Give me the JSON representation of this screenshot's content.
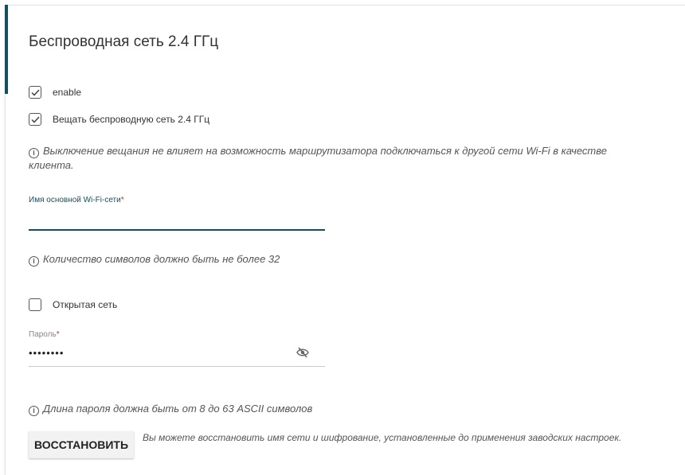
{
  "section": {
    "title": "Беспроводная сеть 2.4 ГГц"
  },
  "checkboxes": {
    "enable": {
      "label": "enable",
      "checked": true
    },
    "broadcast": {
      "label": "Вещать беспроводную сеть 2.4 ГГц",
      "checked": true
    },
    "open_network": {
      "label": "Открытая сеть",
      "checked": false
    }
  },
  "info": {
    "broadcast_note": "Выключение вещания не влияет на возможность маршрутизатора подключаться к другой сети Wi-Fi в качестве клиента.",
    "ssid_note": "Количество символов должно быть не более 32",
    "password_note": "Длина пароля должна быть от 8 до 63 ASCII символов",
    "restore_note": "Вы можете восстановить имя сети и шифрование, установленные до применения заводских настроек."
  },
  "ssid": {
    "label": "Имя основной Wi-Fi-сети",
    "required_mark": "*",
    "value": ""
  },
  "password": {
    "label": "Пароль",
    "required_mark": "*",
    "value": "12345678"
  },
  "buttons": {
    "restore": "ВОССТАНОВИТЬ"
  },
  "icons": {
    "info": "info-circle-icon",
    "checkmark": "checkmark-icon",
    "eye": "eye-slash-icon"
  },
  "colors": {
    "accent": "#13505f",
    "required": "#c0392b"
  }
}
